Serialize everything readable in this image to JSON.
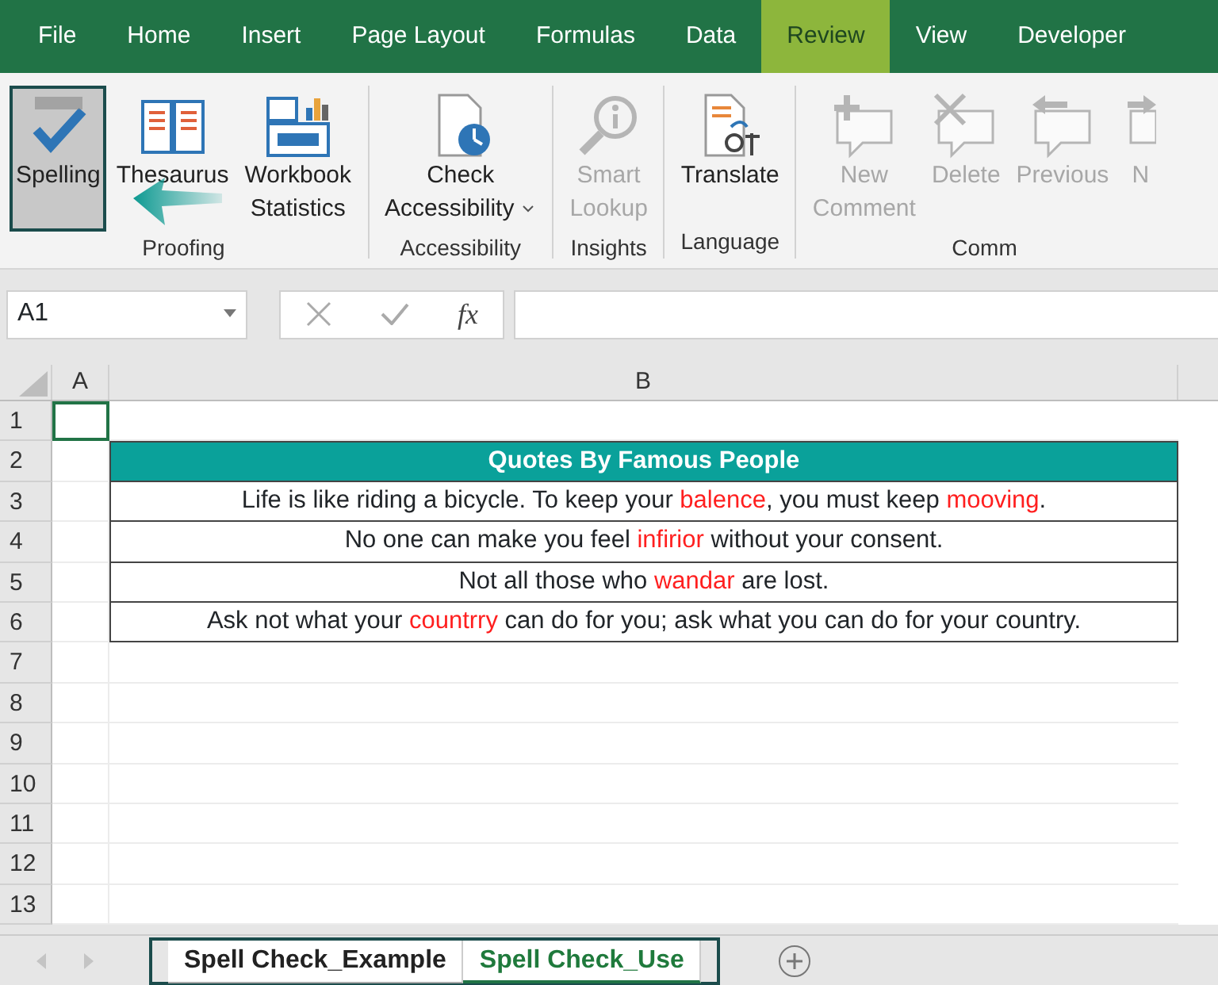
{
  "menu_tabs": [
    {
      "label": "File",
      "selected": false
    },
    {
      "label": "Home",
      "selected": false
    },
    {
      "label": "Insert",
      "selected": false
    },
    {
      "label": "Page Layout",
      "selected": false
    },
    {
      "label": "Formulas",
      "selected": false
    },
    {
      "label": "Data",
      "selected": false
    },
    {
      "label": "Review",
      "selected": true
    },
    {
      "label": "View",
      "selected": false
    },
    {
      "label": "Developer",
      "selected": false
    }
  ],
  "ribbon_groups": [
    {
      "label": "Proofing",
      "buttons": [
        {
          "lines": [
            "Spelling"
          ],
          "selected": true,
          "disabled": false
        },
        {
          "lines": [
            "Thesaurus"
          ],
          "selected": false,
          "disabled": false
        },
        {
          "lines": [
            "Workbook",
            "Statistics"
          ],
          "selected": false,
          "disabled": false
        }
      ]
    },
    {
      "label": "Accessibility",
      "buttons": [
        {
          "lines": [
            "Check",
            "Accessibility"
          ],
          "dropdown": true,
          "selected": false,
          "disabled": false
        }
      ]
    },
    {
      "label": "Insights",
      "buttons": [
        {
          "lines": [
            "Smart",
            "Lookup"
          ],
          "selected": false,
          "disabled": true
        }
      ]
    },
    {
      "label": "Language",
      "buttons": [
        {
          "lines": [
            "Translate"
          ],
          "selected": false,
          "disabled": false
        }
      ]
    },
    {
      "label": "Comm",
      "buttons": [
        {
          "lines": [
            "New",
            "Comment"
          ],
          "selected": false,
          "disabled": true
        },
        {
          "lines": [
            "Delete"
          ],
          "selected": false,
          "disabled": true
        },
        {
          "lines": [
            "Previous"
          ],
          "selected": false,
          "disabled": true
        },
        {
          "lines": [
            "N"
          ],
          "selected": false,
          "disabled": true
        }
      ]
    }
  ],
  "name_box": {
    "value": "A1"
  },
  "formula_bar": {
    "function_symbol": "fx"
  },
  "columns": [
    "A",
    "B"
  ],
  "rows": [
    {
      "header": "1",
      "kind": "empty",
      "a_selected": true
    },
    {
      "header": "2",
      "kind": "header",
      "segments": [
        {
          "text": "Quotes By Famous People",
          "misspelled": false
        }
      ]
    },
    {
      "header": "3",
      "kind": "quote",
      "segments": [
        {
          "text": "Life is like riding a bicycle. To keep your ",
          "misspelled": false
        },
        {
          "text": "balence",
          "misspelled": true
        },
        {
          "text": ", you must keep ",
          "misspelled": false
        },
        {
          "text": "mooving",
          "misspelled": true
        },
        {
          "text": ".",
          "misspelled": false
        }
      ]
    },
    {
      "header": "4",
      "kind": "quote",
      "segments": [
        {
          "text": "No one can make you feel ",
          "misspelled": false
        },
        {
          "text": "infirior",
          "misspelled": true
        },
        {
          "text": " without your consent.",
          "misspelled": false
        }
      ]
    },
    {
      "header": "5",
      "kind": "quote",
      "segments": [
        {
          "text": "Not all those who ",
          "misspelled": false
        },
        {
          "text": "wandar",
          "misspelled": true
        },
        {
          "text": " are lost.",
          "misspelled": false
        }
      ]
    },
    {
      "header": "6",
      "kind": "quote",
      "segments": [
        {
          "text": "Ask not what your ",
          "misspelled": false
        },
        {
          "text": "countrry",
          "misspelled": true
        },
        {
          "text": " can do for you; ask what you can do for your country.",
          "misspelled": false
        }
      ]
    },
    {
      "header": "7",
      "kind": "empty"
    },
    {
      "header": "8",
      "kind": "empty"
    },
    {
      "header": "9",
      "kind": "empty"
    },
    {
      "header": "10",
      "kind": "empty"
    },
    {
      "header": "11",
      "kind": "empty"
    },
    {
      "header": "12",
      "kind": "empty"
    },
    {
      "header": "13",
      "kind": "empty"
    }
  ],
  "sheet_tabs": [
    {
      "label": "Spell Check_Example",
      "selected": false
    },
    {
      "label": "Spell Check_Use",
      "selected": true
    }
  ]
}
